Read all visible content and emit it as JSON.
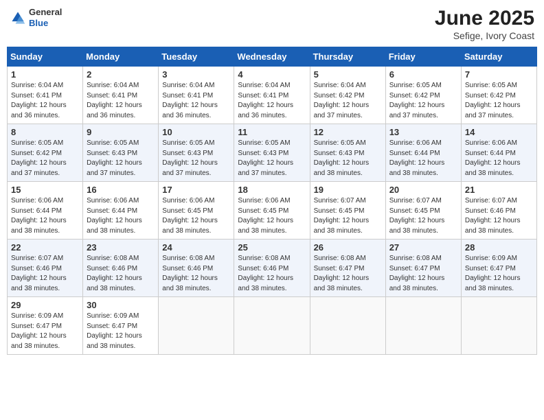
{
  "header": {
    "logo_general": "General",
    "logo_blue": "Blue",
    "title": "June 2025",
    "subtitle": "Sefige, Ivory Coast"
  },
  "days_of_week": [
    "Sunday",
    "Monday",
    "Tuesday",
    "Wednesday",
    "Thursday",
    "Friday",
    "Saturday"
  ],
  "weeks": [
    [
      {
        "day": 1,
        "sunrise": "6:04 AM",
        "sunset": "6:41 PM",
        "daylight": "12 hours and 36 minutes."
      },
      {
        "day": 2,
        "sunrise": "6:04 AM",
        "sunset": "6:41 PM",
        "daylight": "12 hours and 36 minutes."
      },
      {
        "day": 3,
        "sunrise": "6:04 AM",
        "sunset": "6:41 PM",
        "daylight": "12 hours and 36 minutes."
      },
      {
        "day": 4,
        "sunrise": "6:04 AM",
        "sunset": "6:41 PM",
        "daylight": "12 hours and 36 minutes."
      },
      {
        "day": 5,
        "sunrise": "6:04 AM",
        "sunset": "6:42 PM",
        "daylight": "12 hours and 37 minutes."
      },
      {
        "day": 6,
        "sunrise": "6:05 AM",
        "sunset": "6:42 PM",
        "daylight": "12 hours and 37 minutes."
      },
      {
        "day": 7,
        "sunrise": "6:05 AM",
        "sunset": "6:42 PM",
        "daylight": "12 hours and 37 minutes."
      }
    ],
    [
      {
        "day": 8,
        "sunrise": "6:05 AM",
        "sunset": "6:42 PM",
        "daylight": "12 hours and 37 minutes."
      },
      {
        "day": 9,
        "sunrise": "6:05 AM",
        "sunset": "6:43 PM",
        "daylight": "12 hours and 37 minutes."
      },
      {
        "day": 10,
        "sunrise": "6:05 AM",
        "sunset": "6:43 PM",
        "daylight": "12 hours and 37 minutes."
      },
      {
        "day": 11,
        "sunrise": "6:05 AM",
        "sunset": "6:43 PM",
        "daylight": "12 hours and 37 minutes."
      },
      {
        "day": 12,
        "sunrise": "6:05 AM",
        "sunset": "6:43 PM",
        "daylight": "12 hours and 38 minutes."
      },
      {
        "day": 13,
        "sunrise": "6:06 AM",
        "sunset": "6:44 PM",
        "daylight": "12 hours and 38 minutes."
      },
      {
        "day": 14,
        "sunrise": "6:06 AM",
        "sunset": "6:44 PM",
        "daylight": "12 hours and 38 minutes."
      }
    ],
    [
      {
        "day": 15,
        "sunrise": "6:06 AM",
        "sunset": "6:44 PM",
        "daylight": "12 hours and 38 minutes."
      },
      {
        "day": 16,
        "sunrise": "6:06 AM",
        "sunset": "6:44 PM",
        "daylight": "12 hours and 38 minutes."
      },
      {
        "day": 17,
        "sunrise": "6:06 AM",
        "sunset": "6:45 PM",
        "daylight": "12 hours and 38 minutes."
      },
      {
        "day": 18,
        "sunrise": "6:06 AM",
        "sunset": "6:45 PM",
        "daylight": "12 hours and 38 minutes."
      },
      {
        "day": 19,
        "sunrise": "6:07 AM",
        "sunset": "6:45 PM",
        "daylight": "12 hours and 38 minutes."
      },
      {
        "day": 20,
        "sunrise": "6:07 AM",
        "sunset": "6:45 PM",
        "daylight": "12 hours and 38 minutes."
      },
      {
        "day": 21,
        "sunrise": "6:07 AM",
        "sunset": "6:46 PM",
        "daylight": "12 hours and 38 minutes."
      }
    ],
    [
      {
        "day": 22,
        "sunrise": "6:07 AM",
        "sunset": "6:46 PM",
        "daylight": "12 hours and 38 minutes."
      },
      {
        "day": 23,
        "sunrise": "6:08 AM",
        "sunset": "6:46 PM",
        "daylight": "12 hours and 38 minutes."
      },
      {
        "day": 24,
        "sunrise": "6:08 AM",
        "sunset": "6:46 PM",
        "daylight": "12 hours and 38 minutes."
      },
      {
        "day": 25,
        "sunrise": "6:08 AM",
        "sunset": "6:46 PM",
        "daylight": "12 hours and 38 minutes."
      },
      {
        "day": 26,
        "sunrise": "6:08 AM",
        "sunset": "6:47 PM",
        "daylight": "12 hours and 38 minutes."
      },
      {
        "day": 27,
        "sunrise": "6:08 AM",
        "sunset": "6:47 PM",
        "daylight": "12 hours and 38 minutes."
      },
      {
        "day": 28,
        "sunrise": "6:09 AM",
        "sunset": "6:47 PM",
        "daylight": "12 hours and 38 minutes."
      }
    ],
    [
      {
        "day": 29,
        "sunrise": "6:09 AM",
        "sunset": "6:47 PM",
        "daylight": "12 hours and 38 minutes."
      },
      {
        "day": 30,
        "sunrise": "6:09 AM",
        "sunset": "6:47 PM",
        "daylight": "12 hours and 38 minutes."
      },
      null,
      null,
      null,
      null,
      null
    ]
  ]
}
